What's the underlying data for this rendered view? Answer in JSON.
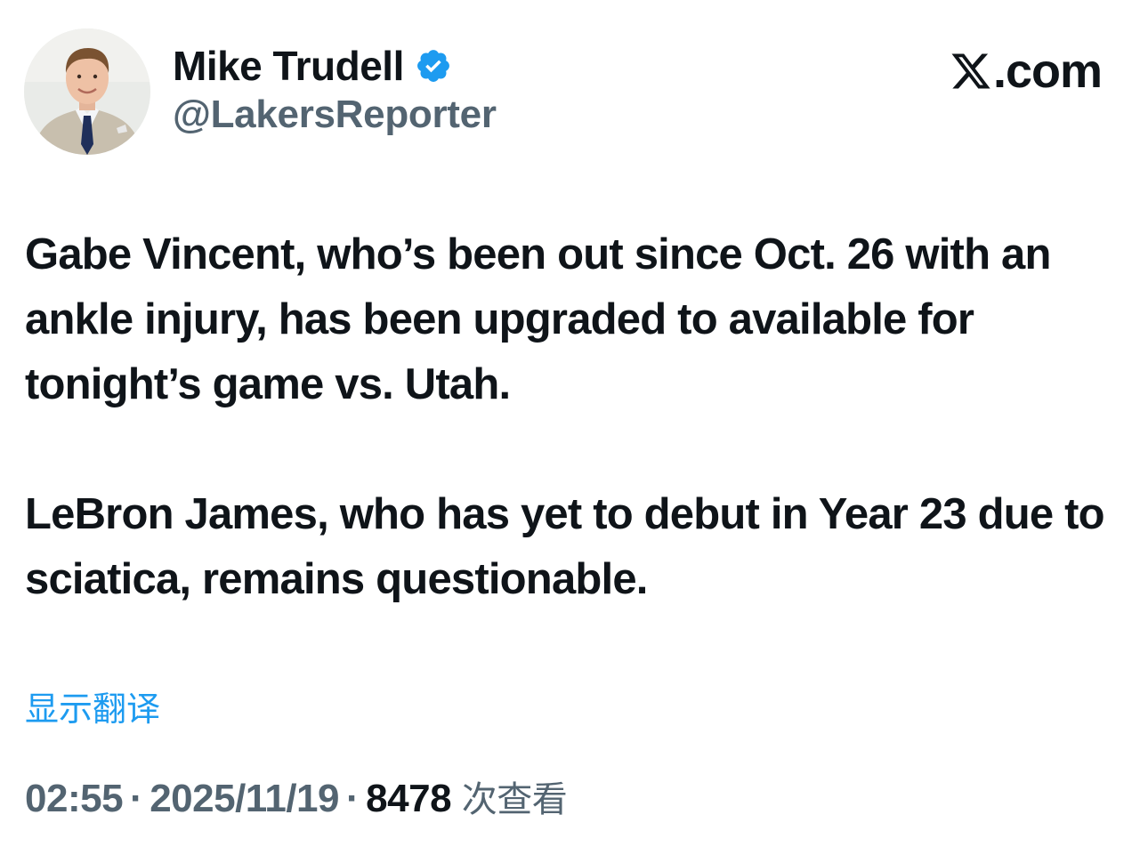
{
  "author": {
    "display_name": "Mike Trudell",
    "handle": "@LakersReporter",
    "verified_icon": "verified-badge-icon",
    "avatar_icon": "profile-photo"
  },
  "brand": {
    "logo_icon": "x-logo-icon",
    "suffix": ".com"
  },
  "tweet": {
    "paragraphs": [
      "Gabe Vincent, who’s been out since Oct. 26 with an ankle injury, has been upgraded to available for tonight’s game vs. Utah.",
      "LeBron James, who has yet to debut in Year 23 due to sciatica, remains questionable."
    ]
  },
  "translate_label": "显示翻译",
  "meta": {
    "time": "02:55",
    "separator": "·",
    "date": "2025/11/19",
    "views_count": "8478",
    "views_label": "次查看"
  },
  "colors": {
    "accent": "#1d9bf0",
    "text_primary": "#0f1419",
    "text_secondary": "#536471"
  }
}
